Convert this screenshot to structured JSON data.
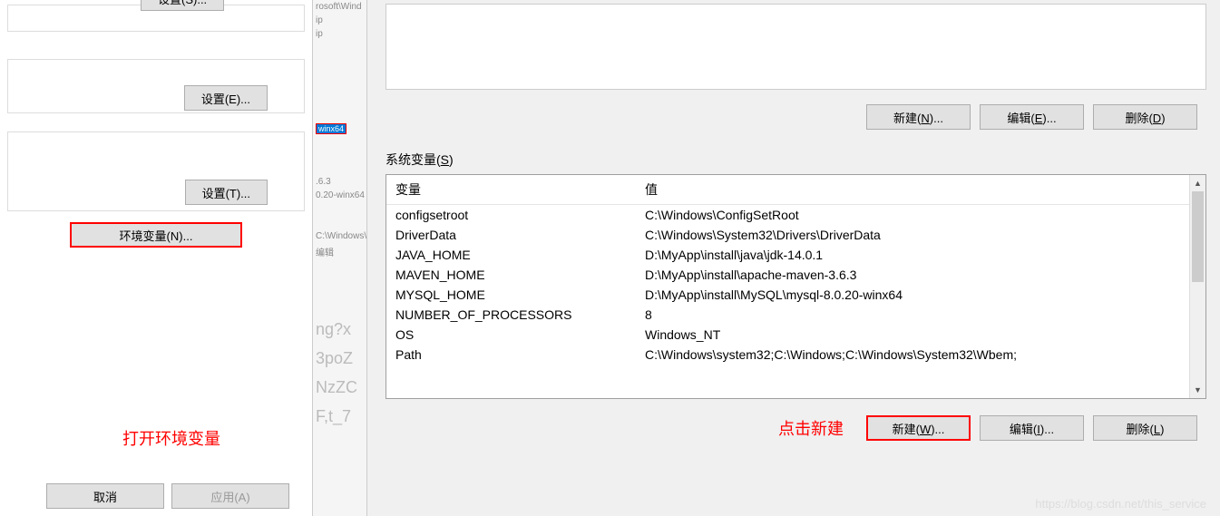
{
  "left": {
    "settingsS": "设置(S)...",
    "settingsE": "设置(E)...",
    "settingsT": "设置(T)...",
    "envVars": "环境变量(N)...",
    "annotation": "打开环境变量",
    "cancel": "取消",
    "apply": "应用(A)"
  },
  "mid": {
    "line1": "rosoft\\Wind",
    "line2": "ip",
    "line3": "ip",
    "highlight": "winx64",
    "line4": ".6.3",
    "line5": "0.20-winx64",
    "line6": "C:\\Windows\\",
    "line7": "编辑",
    "gray1": "ng?x",
    "gray2": "3poZ",
    "gray3": "NzZC",
    "gray4": "F,t_7"
  },
  "right": {
    "topButtons": {
      "new": "新建(N)...",
      "edit": "编辑(E)...",
      "delete": "删除(D)"
    },
    "sysLabel": "系统变量(S)",
    "headers": {
      "var": "变量",
      "val": "值"
    },
    "rows": [
      {
        "var": "configsetroot",
        "val": "C:\\Windows\\ConfigSetRoot"
      },
      {
        "var": "DriverData",
        "val": "C:\\Windows\\System32\\Drivers\\DriverData"
      },
      {
        "var": "JAVA_HOME",
        "val": "D:\\MyApp\\install\\java\\jdk-14.0.1"
      },
      {
        "var": "MAVEN_HOME",
        "val": "D:\\MyApp\\install\\apache-maven-3.6.3"
      },
      {
        "var": "MYSQL_HOME",
        "val": "D:\\MyApp\\install\\MySQL\\mysql-8.0.20-winx64"
      },
      {
        "var": "NUMBER_OF_PROCESSORS",
        "val": "8"
      },
      {
        "var": "OS",
        "val": "Windows_NT"
      },
      {
        "var": "Path",
        "val": "C:\\Windows\\system32;C:\\Windows;C:\\Windows\\System32\\Wbem;"
      }
    ],
    "botButtons": {
      "new": "新建(W)...",
      "edit": "编辑(I)...",
      "delete": "删除(L)"
    },
    "annotation": "点击新建"
  },
  "watermark": "https://blog.csdn.net/this_service"
}
